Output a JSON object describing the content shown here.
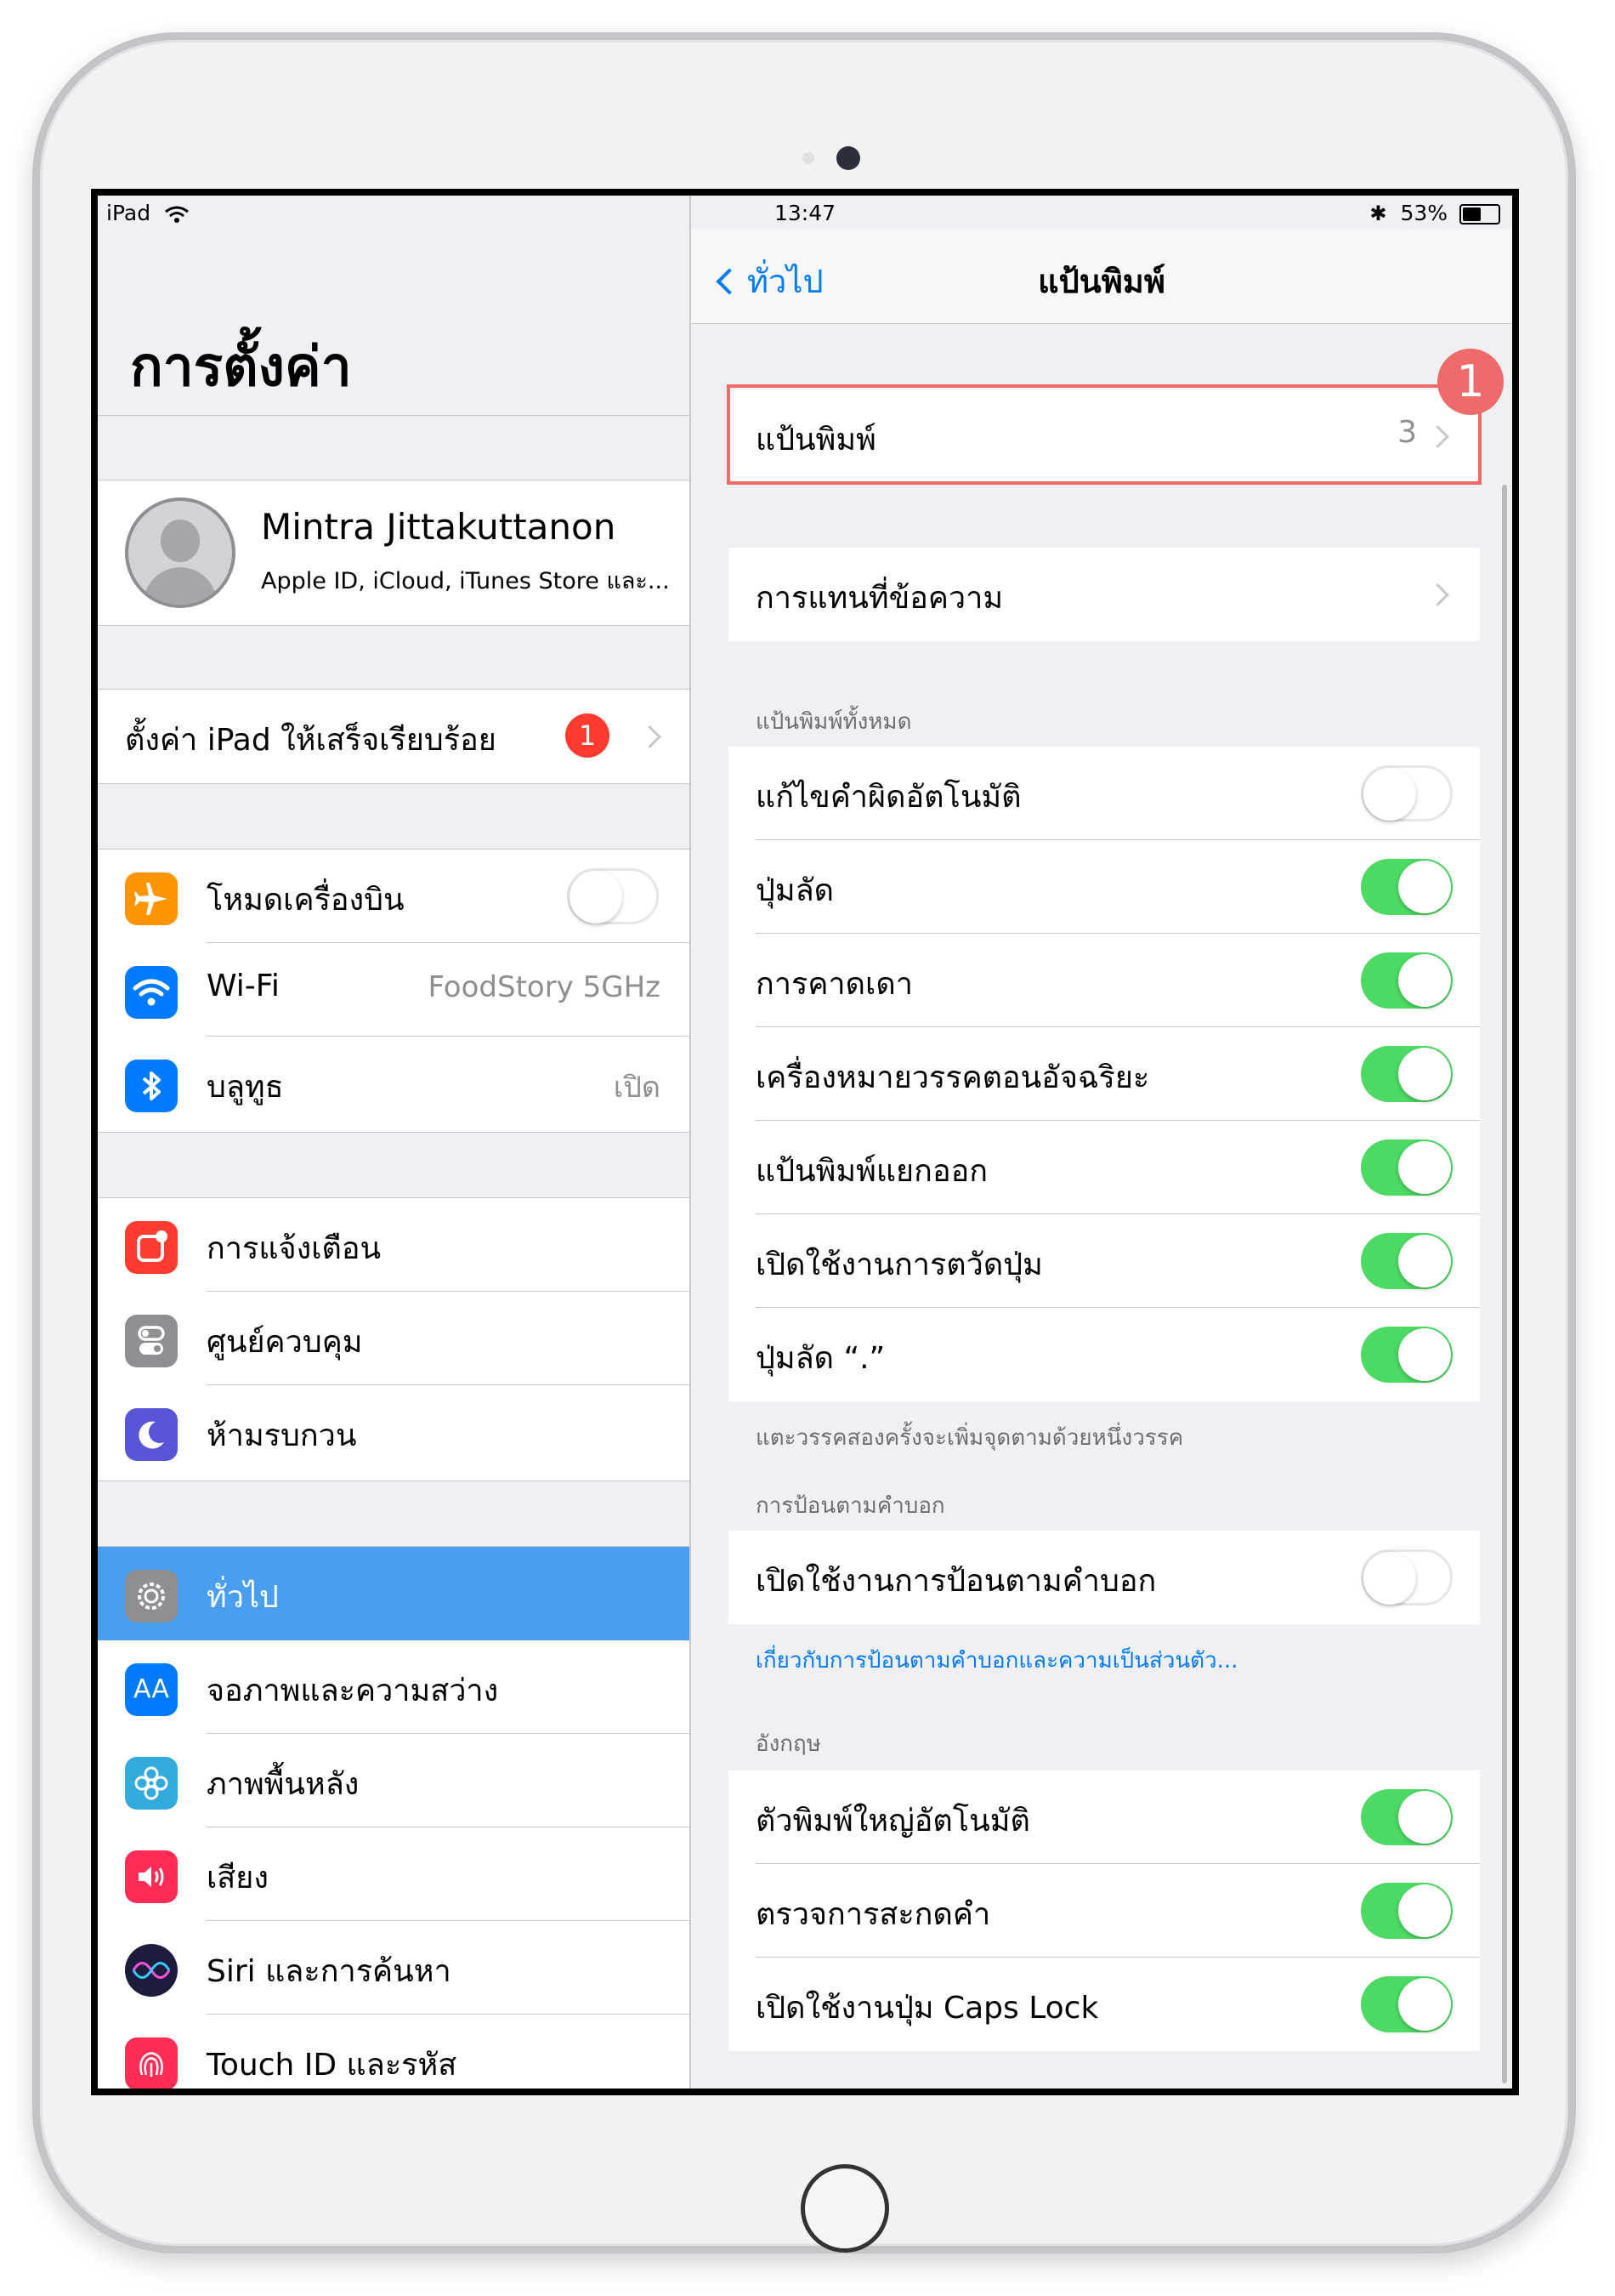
{
  "status_bar": {
    "device": "iPad",
    "time": "13:47",
    "battery": "53%",
    "battery_level": 0.53
  },
  "sidebar": {
    "title": "การตั้งค่า",
    "profile": {
      "name": "Mintra Jittakuttanon",
      "subtitle": "Apple ID, iCloud, iTunes Store และ..."
    },
    "setup": {
      "label": "ตั้งค่า iPad ให้เสร็จเรียบร้อย",
      "badge": "1"
    },
    "connectivity": [
      {
        "label": "โหมดเครื่องบิน",
        "icon": "airplane-icon",
        "color": "#ff9500",
        "toggle": false
      },
      {
        "label": "Wi-Fi",
        "icon": "wifi-icon",
        "color": "#007aff",
        "value": "FoodStory 5GHz"
      },
      {
        "label": "บลูทูธ",
        "icon": "bluetooth-icon",
        "color": "#007aff",
        "value": "เปิด"
      }
    ],
    "notifications": [
      {
        "label": "การแจ้งเตือน",
        "icon": "notifications-icon",
        "color": "#ff3b30"
      },
      {
        "label": "ศูนย์ควบคุม",
        "icon": "control-center-icon",
        "color": "#8e8e93"
      },
      {
        "label": "ห้ามรบกวน",
        "icon": "moon-icon",
        "color": "#5856d6"
      }
    ],
    "general": [
      {
        "label": "ทั่วไป",
        "icon": "gear-icon",
        "color": "#8e8e93",
        "selected": true
      },
      {
        "label": "จอภาพและความสว่าง",
        "icon": "display-icon",
        "color": "#007aff",
        "glyph": "AA"
      },
      {
        "label": "ภาพพื้นหลัง",
        "icon": "wallpaper-icon",
        "color": "#34aadc"
      },
      {
        "label": "เสียง",
        "icon": "sound-icon",
        "color": "#ff2d55"
      },
      {
        "label": "Siri และการค้นหา",
        "icon": "siri-icon",
        "color": "#1c1c3c"
      },
      {
        "label": "Touch ID และรหัส",
        "icon": "fingerprint-icon",
        "color": "#ff2d55"
      }
    ]
  },
  "detail": {
    "nav": {
      "back_label": "ทั่วไป",
      "title": "แป้นพิมพ์"
    },
    "keyboards_row": {
      "label": "แป้นพิมพ์",
      "value": "3"
    },
    "callout_number": "1",
    "text_replacement": {
      "label": "การแทนที่ข้อความ"
    },
    "all_keyboards": {
      "header": "แป้นพิมพ์ทั้งหมด",
      "rows": [
        {
          "label": "แก้ไขคำผิดอัตโนมัติ",
          "toggle": false
        },
        {
          "label": "ปุ่มลัด",
          "toggle": true
        },
        {
          "label": "การคาดเดา",
          "toggle": true
        },
        {
          "label": "เครื่องหมายวรรคตอนอัจฉริยะ",
          "toggle": true
        },
        {
          "label": "แป้นพิมพ์แยกออก",
          "toggle": true
        },
        {
          "label": "เปิดใช้งานการตวัดปุ่ม",
          "toggle": true
        },
        {
          "label": "ปุ่มลัด “.”",
          "toggle": true
        }
      ],
      "footer": "แตะวรรคสองครั้งจะเพิ่มจุดตามด้วยหนึ่งวรรค"
    },
    "dictation": {
      "header": "การป้อนตามคำบอก",
      "row": {
        "label": "เปิดใช้งานการป้อนตามคำบอก",
        "toggle": false
      },
      "link": "เกี่ยวกับการป้อนตามคำบอกและความเป็นส่วนตัว..."
    },
    "english": {
      "header": "อังกฤษ",
      "rows": [
        {
          "label": "ตัวพิมพ์ใหญ่อัตโนมัติ",
          "toggle": true
        },
        {
          "label": "ตรวจการสะกดคำ",
          "toggle": true
        },
        {
          "label": "เปิดใช้งานปุ่ม Caps Lock",
          "toggle": true
        }
      ]
    }
  },
  "colors": {
    "accent": "#007aff",
    "toggle_on": "#4cd964",
    "highlight": "#f06a6a",
    "selected_row": "#4a9ef0"
  }
}
